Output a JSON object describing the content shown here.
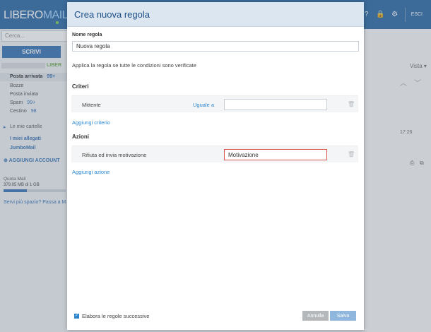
{
  "app": {
    "logo_main": "LIBERO",
    "logo_accent": "MAIL",
    "header_icons": [
      "help-icon",
      "lock-icon",
      "gear-icon"
    ],
    "help_glyph": "?",
    "lock_glyph": "🔒",
    "gear_glyph": "⚙",
    "logout_label": "ESCI"
  },
  "sidebar": {
    "search_placeholder": "Cerca...",
    "compose_label": "SCRIVI",
    "account_label": "LIBER",
    "folders": [
      {
        "label": "Posta arrivata",
        "count": "99+"
      },
      {
        "label": "Bozze",
        "count": ""
      },
      {
        "label": "Posta inviata",
        "count": ""
      },
      {
        "label": "Spam",
        "count": "99+"
      },
      {
        "label": "Cestino",
        "count": "98"
      }
    ],
    "my_folders_label": "Le mie cartelle",
    "attachments_label": "I miei allegati",
    "jumbomail_label": "JumboMail",
    "add_account_label": "AGGIUNGI ACCOUNT",
    "quota_label": "Quota Mail",
    "quota_value": "379.05 MB di 1 GB",
    "quota_fraction": 0.37,
    "upsell_label": "Servi più spazio? Passa a M"
  },
  "rightpane": {
    "view_label": "Vista",
    "time_label": "17:26"
  },
  "modal": {
    "title": "Crea nuova regola",
    "rule_name_label": "Nome regola",
    "rule_name_value": "Nuova regola",
    "apply_text": "Applica la regola se tutte le condizioni sono verificate",
    "criteria_section": "Criteri",
    "criteria": [
      {
        "field": "Mittente",
        "operator": "Uguale a",
        "value": ""
      }
    ],
    "add_criterion": "Aggiungi criterio",
    "actions_section": "Azioni",
    "actions": [
      {
        "action": "Rifiuta ed invia motivazione",
        "value": "Motivazione"
      }
    ],
    "add_action": "Aggiungi azione",
    "process_next_label": "Elabora le regole successive",
    "process_next_checked": true,
    "cancel_label": "Annulla",
    "save_label": "Salva"
  }
}
